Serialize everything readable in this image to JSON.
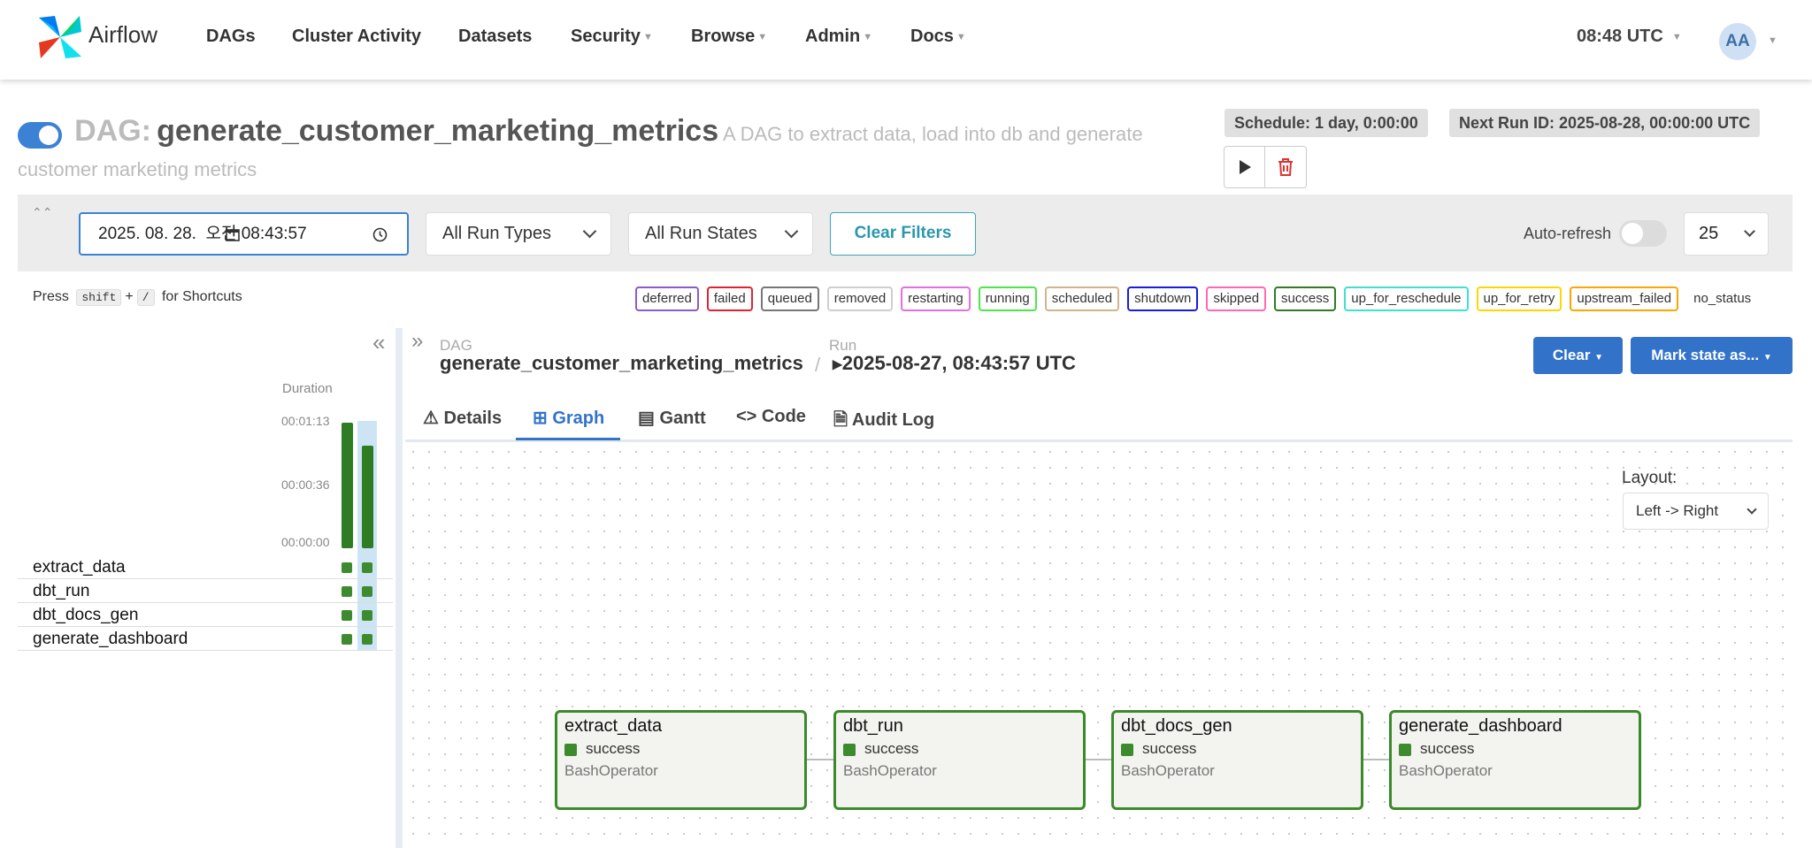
{
  "nav": {
    "brand": "Airflow",
    "items": [
      {
        "label": "DAGs",
        "dropdown": false
      },
      {
        "label": "Cluster Activity",
        "dropdown": false
      },
      {
        "label": "Datasets",
        "dropdown": false
      },
      {
        "label": "Security",
        "dropdown": true
      },
      {
        "label": "Browse",
        "dropdown": true
      },
      {
        "label": "Admin",
        "dropdown": true
      },
      {
        "label": "Docs",
        "dropdown": true
      }
    ],
    "time": "08:48 UTC",
    "avatar": "AA"
  },
  "dag": {
    "label": "DAG:",
    "name": "generate_customer_marketing_metrics",
    "description": "A DAG to extract data, load into db and generate customer marketing metrics",
    "schedule": "Schedule: 1 day, 0:00:00",
    "next_run": "Next Run ID: 2025-08-28, 00:00:00 UTC"
  },
  "filters": {
    "datetime": "2025. 08. 28.  오전 08:43:57",
    "run_types": "All Run Types",
    "run_states": "All Run States",
    "clear_filters": "Clear Filters",
    "auto_refresh": "Auto-refresh",
    "num_runs": "25"
  },
  "shortcuts": {
    "press": "Press",
    "key1": "shift",
    "plus": "+",
    "key2": "/",
    "suffix": "for Shortcuts"
  },
  "states": [
    {
      "label": "deferred",
      "color": "#8b5cc8"
    },
    {
      "label": "failed",
      "color": "#e0242f"
    },
    {
      "label": "queued",
      "color": "#777777"
    },
    {
      "label": "removed",
      "color": "#cfcfcf"
    },
    {
      "label": "restarting",
      "color": "#e46fe4"
    },
    {
      "label": "running",
      "color": "#4ce64c"
    },
    {
      "label": "scheduled",
      "color": "#d2b48c"
    },
    {
      "label": "shutdown",
      "color": "#1a1ae0"
    },
    {
      "label": "skipped",
      "color": "#ff69b4"
    },
    {
      "label": "success",
      "color": "#2e7d24"
    },
    {
      "label": "up_for_reschedule",
      "color": "#40e0d0"
    },
    {
      "label": "up_for_retry",
      "color": "#ffd700"
    },
    {
      "label": "upstream_failed",
      "color": "#ffa500"
    },
    {
      "label": "no_status",
      "color": "transparent"
    }
  ],
  "grid": {
    "duration_label": "Duration",
    "ticks": [
      "00:01:13",
      "00:00:36",
      "00:00:00"
    ],
    "tasks": [
      "extract_data",
      "dbt_run",
      "dbt_docs_gen",
      "generate_dashboard"
    ]
  },
  "breadcrumb": {
    "dag_label": "DAG",
    "dag_name": "generate_customer_marketing_metrics",
    "sep": "/",
    "run_label": "Run",
    "run_value": "2025-08-27, 08:43:57 UTC"
  },
  "actions": {
    "clear": "Clear",
    "mark_state": "Mark state as..."
  },
  "tabs": [
    {
      "label": "Details",
      "icon": "warning-triangle-icon"
    },
    {
      "label": "Graph",
      "icon": "graph-icon"
    },
    {
      "label": "Gantt",
      "icon": "gantt-icon"
    },
    {
      "label": "Code",
      "icon": "code-icon"
    },
    {
      "label": "Audit Log",
      "icon": "document-icon"
    }
  ],
  "graph": {
    "layout_label": "Layout:",
    "layout_value": "Left -> Right",
    "nodes": [
      {
        "name": "extract_data",
        "state": "success",
        "operator": "BashOperator"
      },
      {
        "name": "dbt_run",
        "state": "success",
        "operator": "BashOperator"
      },
      {
        "name": "dbt_docs_gen",
        "state": "success",
        "operator": "BashOperator"
      },
      {
        "name": "generate_dashboard",
        "state": "success",
        "operator": "BashOperator"
      }
    ]
  }
}
